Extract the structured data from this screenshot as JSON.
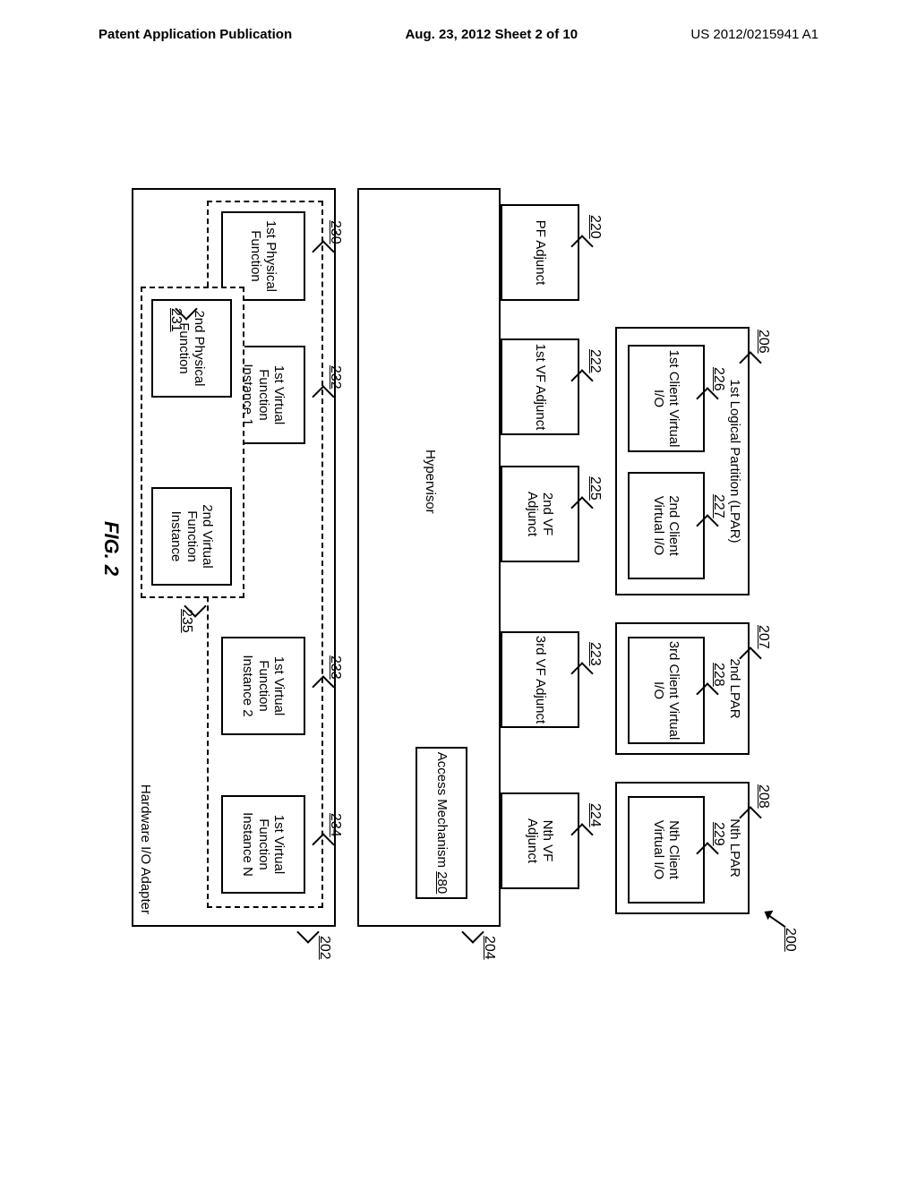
{
  "page_header": {
    "left": "Patent Application Publication",
    "mid": "Aug. 23, 2012  Sheet 2 of 10",
    "right": "US 2012/0215941 A1"
  },
  "refs": {
    "r200": "200",
    "r202": "202",
    "r204": "204",
    "r206": "206",
    "r207": "207",
    "r208": "208",
    "r220": "220",
    "r222": "222",
    "r223": "223",
    "r224": "224",
    "r225": "225",
    "r226": "226",
    "r227": "227",
    "r228": "228",
    "r229": "229",
    "r230": "230",
    "r231": "231",
    "r232": "232",
    "r233": "233",
    "r234": "234",
    "r235": "235",
    "r280": "280"
  },
  "lpar": {
    "lpar1_title": "1st Logical Partition (LPAR)",
    "lpar2_title": "2nd LPAR",
    "lparN_title": "Nth LPAR",
    "vio1": "1st Client Virtual I/O",
    "vio2": "2nd Client Virtual I/O",
    "vio3": "3rd Client Virtual I/O",
    "vioN": "Nth Client Virtual I/O"
  },
  "adjuncts": {
    "pf": "PF Adjunct",
    "vf1": "1st VF Adjunct",
    "vf2": "2nd VF Adjunct",
    "vf3": "3rd VF Adjunct",
    "vfN": "Nth VF Adjunct"
  },
  "hypervisor": {
    "label": "Hypervisor",
    "access_prefix": "Access Mechanism "
  },
  "adapter": {
    "label": "Hardware I/O Adapter",
    "pf1": "1st Physical Function",
    "pf2": "2nd Physical Function",
    "vfi1": "1st Virtual Function Instance 1",
    "vfi2": "1st Virtual Function Instance 2",
    "vfiN": "1st Virtual Function Instance N",
    "vf2i": "2nd Virtual Function Instance"
  },
  "figure_caption": "FIG. 2"
}
